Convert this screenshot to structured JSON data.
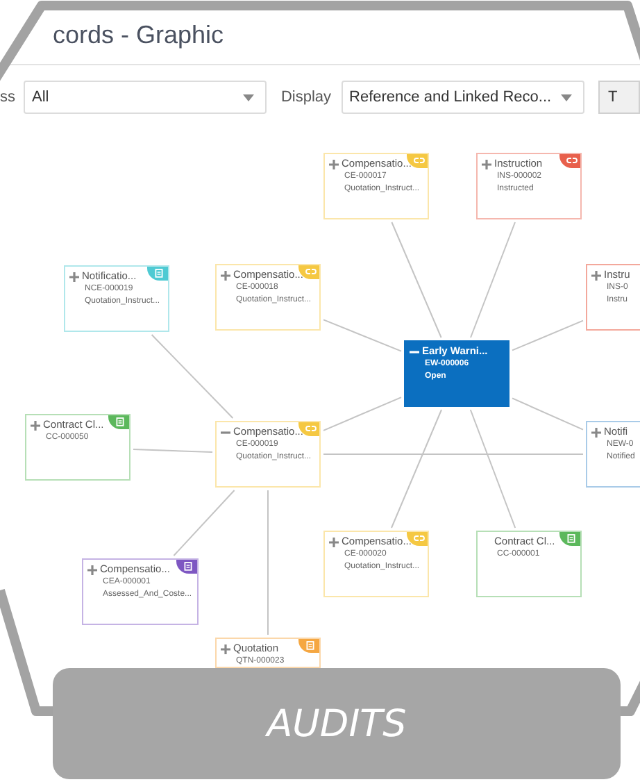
{
  "header": {
    "title": "cords - Graphic"
  },
  "toolbar": {
    "filter_label": "ss",
    "filter_value": "All",
    "display_label": "Display",
    "display_value": "Reference and Linked Reco...",
    "button_label": "T"
  },
  "nodes": [
    {
      "kind": "link",
      "title": "Compensatio...",
      "lines": [
        "CE-000017",
        "Quotation_Instruct..."
      ],
      "color": "#f5c842",
      "expandable": true,
      "expanded": false
    },
    {
      "kind": "link",
      "title": "Instruction",
      "lines": [
        "INS-000002",
        "Instructed"
      ],
      "color": "#e8604c",
      "expandable": true,
      "expanded": false
    },
    {
      "kind": "document",
      "title": "Notificatio...",
      "lines": [
        "NCE-000019",
        "Quotation_Instruct..."
      ],
      "color": "#4fcad3",
      "expandable": true,
      "expanded": false
    },
    {
      "kind": "link",
      "title": "Compensatio...",
      "lines": [
        "CE-000018",
        "Quotation_Instruct..."
      ],
      "color": "#f5c842",
      "expandable": true,
      "expanded": false
    },
    {
      "kind": "plain",
      "title": "Instru",
      "lines": [
        "INS-0",
        "Instru"
      ],
      "color": "#f3a89c",
      "expandable": true,
      "expanded": false
    },
    {
      "kind": "focus",
      "title": "Early Warni...",
      "lines": [
        "EW-000006",
        "Open"
      ],
      "color": "#0b6fc0",
      "expandable": true,
      "expanded": true
    },
    {
      "kind": "document",
      "title": "Contract Cl...",
      "lines": [
        "CC-000050"
      ],
      "color": "#5cb85c",
      "expandable": true,
      "expanded": false
    },
    {
      "kind": "link",
      "title": "Compensatio...",
      "lines": [
        "CE-000019",
        "Quotation_Instruct..."
      ],
      "color": "#f5c842",
      "expandable": true,
      "expanded": true
    },
    {
      "kind": "plain",
      "title": "Notifi",
      "lines": [
        "NEW-0",
        "Notified"
      ],
      "color": "#a9cbe8",
      "expandable": true,
      "expanded": false
    },
    {
      "kind": "link",
      "title": "Compensatio...",
      "lines": [
        "CE-000020",
        "Quotation_Instruct..."
      ],
      "color": "#f5c842",
      "expandable": true,
      "expanded": false
    },
    {
      "kind": "document",
      "title": "Contract Cl...",
      "lines": [
        "CC-000001"
      ],
      "color": "#5cb85c",
      "expandable": false,
      "expanded": false
    },
    {
      "kind": "document",
      "title": "Compensatio...",
      "lines": [
        "CEA-000001",
        "Assessed_And_Coste..."
      ],
      "color": "#7e57c2",
      "expandable": true,
      "expanded": false
    },
    {
      "kind": "document",
      "title": "Quotation",
      "lines": [
        "QTN-000023"
      ],
      "color": "#f5a742",
      "expandable": true,
      "expanded": false
    }
  ],
  "banner": {
    "label": "AUDITS"
  }
}
